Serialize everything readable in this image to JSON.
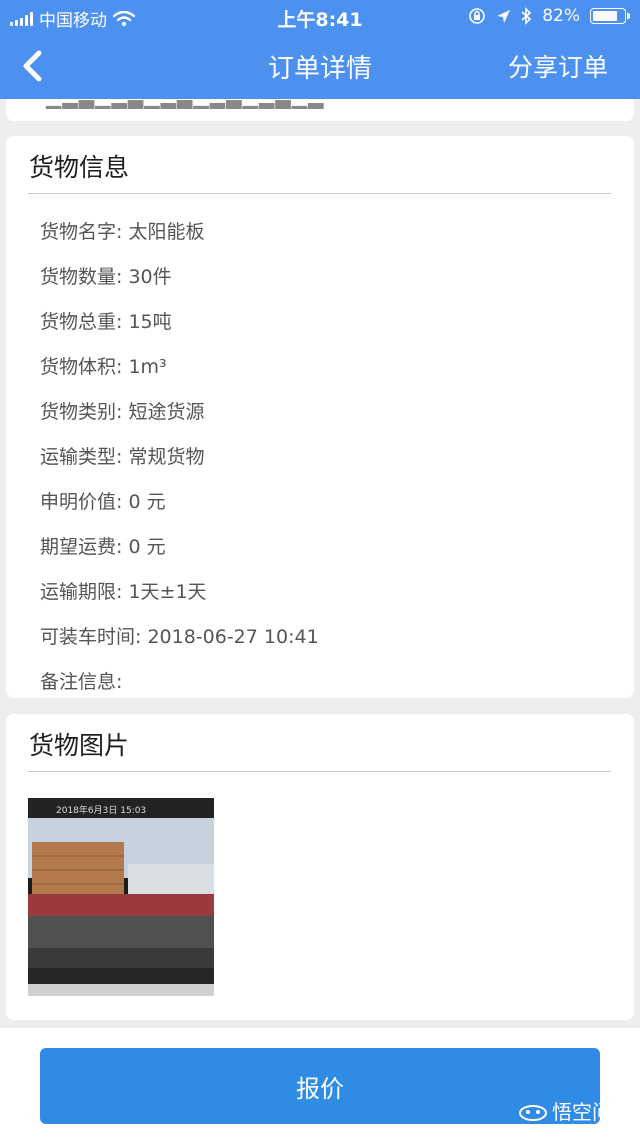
{
  "status": {
    "carrier": "中国移动",
    "time": "上午8:41",
    "battery": "82%",
    "battery_level": 0.82
  },
  "header": {
    "title": "订单详情",
    "share": "分享订单"
  },
  "cargo": {
    "title": "货物信息",
    "rows": [
      "货物名字: 太阳能板",
      "货物数量: 30件",
      "货物总重: 15吨",
      "货物体积: 1m³",
      "货物类别: 短途货源",
      "运输类型: 常规货物",
      "申明价值: 0 元",
      "期望运费: 0 元",
      "运输期限: 1天±1天",
      "可装车时间: 2018-06-27 10:41",
      "备注信息:"
    ]
  },
  "photos": {
    "title": "货物图片",
    "thumb_date": "2018年6月3日 15:03"
  },
  "action": {
    "quote": "报价"
  },
  "watermark": {
    "text": "悟空问答"
  },
  "colors": {
    "header": "#4c91ef",
    "button": "#2f8be3"
  }
}
